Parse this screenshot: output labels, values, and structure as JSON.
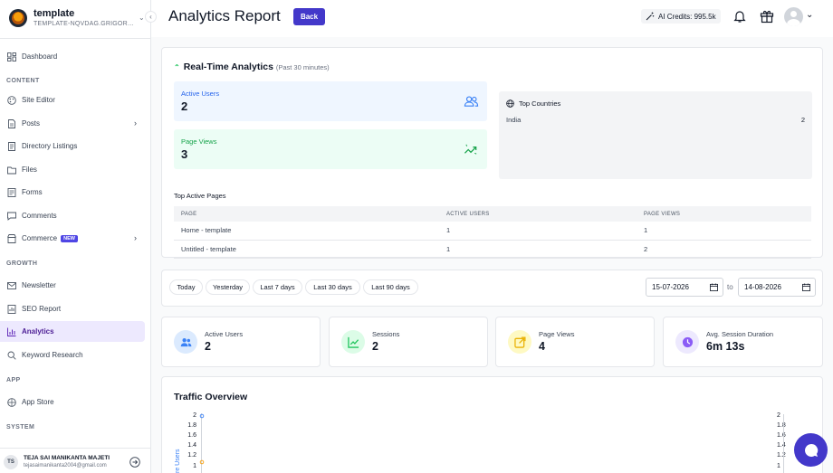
{
  "workspace": {
    "name": "template",
    "subtitle": "TEMPLATE-NQVDAG.GRIGOR…"
  },
  "sidebar": {
    "items": [
      {
        "label": "Dashboard",
        "icon": "dashboard-icon"
      },
      {
        "section": "CONTENT"
      },
      {
        "label": "Site Editor",
        "icon": "palette-icon"
      },
      {
        "label": "Posts",
        "icon": "document-icon",
        "has_submenu": true
      },
      {
        "label": "Directory Listings",
        "icon": "directory-icon"
      },
      {
        "label": "Files",
        "icon": "folder-icon"
      },
      {
        "label": "Forms",
        "icon": "form-icon"
      },
      {
        "label": "Comments",
        "icon": "comment-icon"
      },
      {
        "label": "Commerce",
        "icon": "store-icon",
        "badge": "NEW",
        "has_submenu": true
      },
      {
        "section": "GROWTH"
      },
      {
        "label": "Newsletter",
        "icon": "mail-icon"
      },
      {
        "label": "SEO Report",
        "icon": "report-icon"
      },
      {
        "label": "Analytics",
        "icon": "bar-chart-icon",
        "active": true
      },
      {
        "label": "Keyword Research",
        "icon": "search-icon"
      },
      {
        "section": "APP"
      },
      {
        "label": "App Store",
        "icon": "apps-icon"
      },
      {
        "section": "SYSTEM"
      }
    ],
    "section_content": "CONTENT",
    "section_growth": "GROWTH",
    "section_app": "APP",
    "section_system": "SYSTEM",
    "labels": {
      "dashboard": "Dashboard",
      "site_editor": "Site Editor",
      "posts": "Posts",
      "directory": "Directory Listings",
      "files": "Files",
      "forms": "Forms",
      "comments": "Comments",
      "commerce": "Commerce",
      "commerce_badge": "NEW",
      "newsletter": "Newsletter",
      "seo": "SEO Report",
      "analytics": "Analytics",
      "keyword": "Keyword Research",
      "app_store": "App Store"
    }
  },
  "user": {
    "initials": "TS",
    "name": "TEJA SAI MANIKANTA MAJETI",
    "email": "tejasaimanikanta2004@gmail.com"
  },
  "header": {
    "title": "Analytics Report",
    "back_label": "Back",
    "credits": "AI Credits: 995.5k"
  },
  "realtime": {
    "title": "Real-Time Analytics",
    "subtitle": "(Past 30 minutes)",
    "active_users_label": "Active Users",
    "active_users_value": "2",
    "page_views_label": "Page Views",
    "page_views_value": "3",
    "top_countries_label": "Top Countries",
    "countries": [
      {
        "name": "India",
        "value": "2"
      }
    ],
    "top_pages_label": "Top Active Pages",
    "table_headers": [
      "PAGE",
      "ACTIVE USERS",
      "PAGE VIEWS"
    ],
    "rows": [
      {
        "page": "Home - template",
        "active_users": "1",
        "page_views": "1"
      },
      {
        "page": "Untitled - template",
        "active_users": "1",
        "page_views": "2"
      }
    ]
  },
  "date_range": {
    "presets": [
      "Today",
      "Yesterday",
      "Last 7 days",
      "Last 30 days",
      "Last 90 days"
    ],
    "from": "15-07-2026",
    "to_label": "to",
    "to": "14-08-2026"
  },
  "metrics": [
    {
      "label": "Active Users",
      "value": "2",
      "icon": "users-icon",
      "color": "#3b82f6"
    },
    {
      "label": "Sessions",
      "value": "2",
      "icon": "trend-icon",
      "color": "#22c55e"
    },
    {
      "label": "Page Views",
      "value": "4",
      "icon": "external-link-icon",
      "color": "#eab308"
    },
    {
      "label": "Avg. Session Duration",
      "value": "6m 13s",
      "icon": "clock-icon",
      "color": "#8b5cf6"
    }
  ],
  "traffic": {
    "title": "Traffic Overview",
    "y_ticks": [
      "2",
      "1.8",
      "1.6",
      "1.4",
      "1.2",
      "1"
    ],
    "left_axis_label": "re Users"
  },
  "colors": {
    "accent": "#4338ca",
    "active_bg": "#ede9fe"
  }
}
